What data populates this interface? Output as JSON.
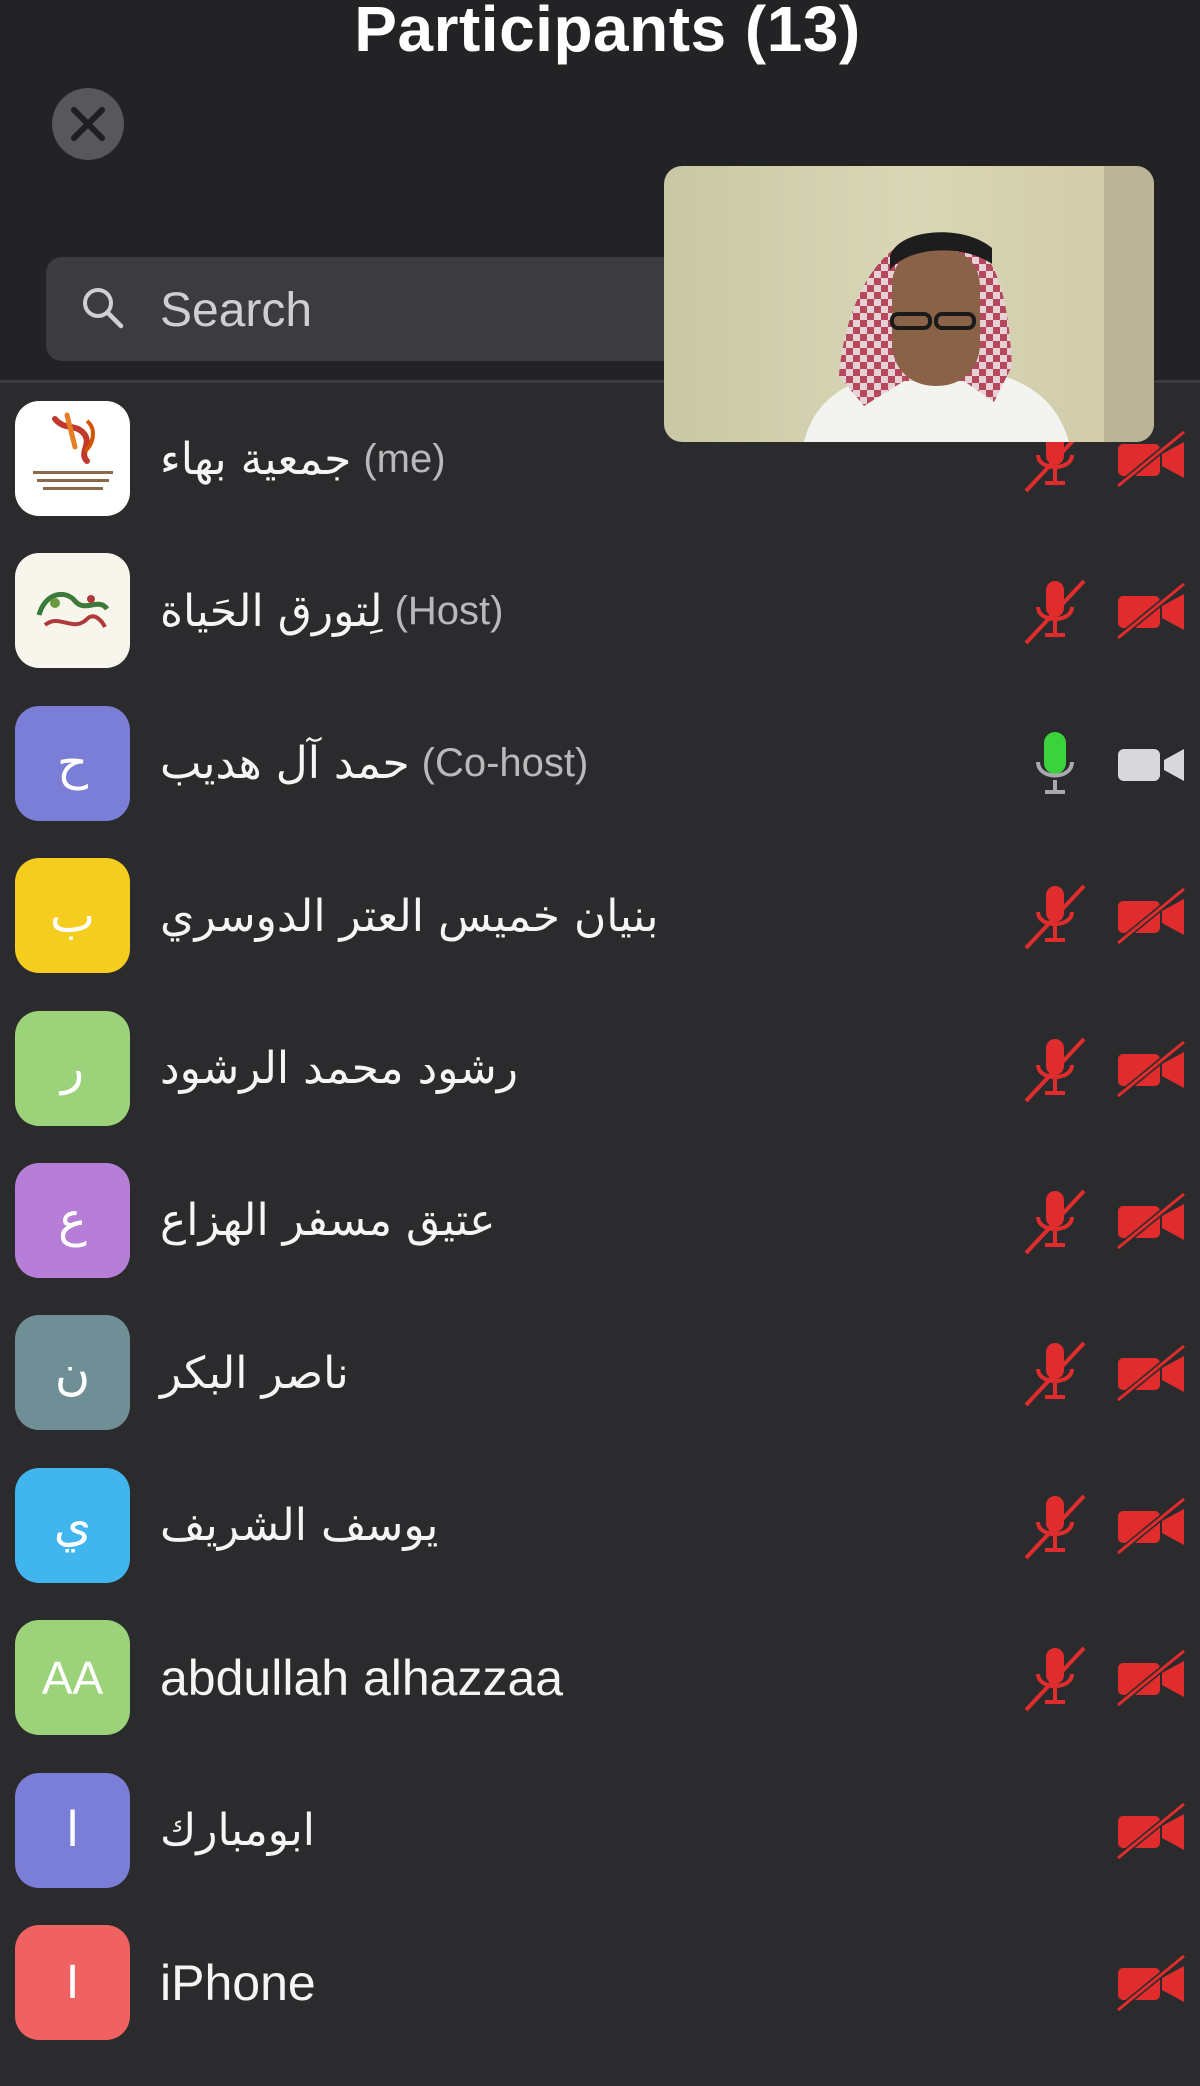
{
  "header": {
    "title": "Participants (13)",
    "search_placeholder": "Search"
  },
  "colors": {
    "background": "#2b2b2d",
    "muted_icon": "#e02c2c",
    "active_mic": "#3bd33b",
    "active_cam": "#d8d8dc"
  },
  "participants": [
    {
      "name": "جمعية بهاء",
      "role": "(me)",
      "avatar_text": "",
      "avatar_type": "logo",
      "mic": "muted",
      "cam": "off"
    },
    {
      "name": "لِتورق الحَياة",
      "role": "(Host)",
      "avatar_text": "",
      "avatar_type": "logo",
      "mic": "muted",
      "cam": "off"
    },
    {
      "name": "حمد آل هديب",
      "role": "(Co-host)",
      "avatar_text": "ح",
      "avatar_color": "#7a7ed6",
      "mic": "on",
      "cam": "on"
    },
    {
      "name": "بنيان خميس العتر الدوسري",
      "role": "",
      "avatar_text": "ب",
      "avatar_color": "#f5cd1f",
      "mic": "muted",
      "cam": "off"
    },
    {
      "name": "رشود محمد الرشود",
      "role": "",
      "avatar_text": "ر",
      "avatar_color": "#9bd27a",
      "mic": "muted",
      "cam": "off"
    },
    {
      "name": "عتيق مسفر الهزاع",
      "role": "",
      "avatar_text": "ع",
      "avatar_color": "#b67ed6",
      "mic": "muted",
      "cam": "off"
    },
    {
      "name": "ناصر البكر",
      "role": "",
      "avatar_text": "ن",
      "avatar_color": "#6f8e96",
      "mic": "muted",
      "cam": "off"
    },
    {
      "name": "يوسف الشريف",
      "role": "",
      "avatar_text": "ي",
      "avatar_color": "#41b6ee",
      "mic": "muted",
      "cam": "off"
    },
    {
      "name": "abdullah alhazzaa",
      "role": "",
      "avatar_text": "AA",
      "avatar_color": "#9bd27a",
      "mic": "muted",
      "cam": "off"
    },
    {
      "name": "ابومبارك",
      "role": "",
      "avatar_text": "ا",
      "avatar_color": "#7a7ed6",
      "mic": "none",
      "cam": "off"
    },
    {
      "name": "iPhone",
      "role": "",
      "avatar_text": "I",
      "avatar_color": "#f06262",
      "mic": "none",
      "cam": "off"
    }
  ]
}
